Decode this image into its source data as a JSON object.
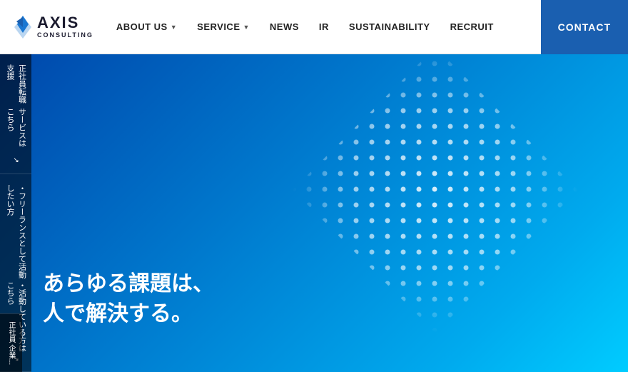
{
  "header": {
    "logo": {
      "axis": "AXIS",
      "consulting": "CONSULTING"
    },
    "nav": [
      {
        "label": "ABOUT US",
        "hasDropdown": true
      },
      {
        "label": "SERVICE",
        "hasDropdown": true
      },
      {
        "label": "NEWS",
        "hasDropdown": false
      },
      {
        "label": "IR",
        "hasDropdown": false
      },
      {
        "label": "SUSTAINABILITY",
        "hasDropdown": false
      },
      {
        "label": "RECRUIT",
        "hasDropdown": false
      }
    ],
    "contact": "CONTACT"
  },
  "sidebar": {
    "tab1_line1": "正社員転職支援",
    "tab1_line2": "サービスはこちら",
    "tab1_icon": "↗",
    "tab2_line1": "・フリーランスとして活動したい方",
    "tab2_line2": "・活動している方はこちら",
    "tab2_icon": "↗",
    "tab3_label": "正社員",
    "tab3_sub": "企業..."
  },
  "hero": {
    "line1": "あらゆる課題は、",
    "line2": "人で解決する。"
  },
  "colors": {
    "nav_bg": "#ffffff",
    "contact_bg": "#1a5fb0",
    "hero_bg_start": "#0047ab",
    "hero_bg_end": "#00ccff"
  }
}
